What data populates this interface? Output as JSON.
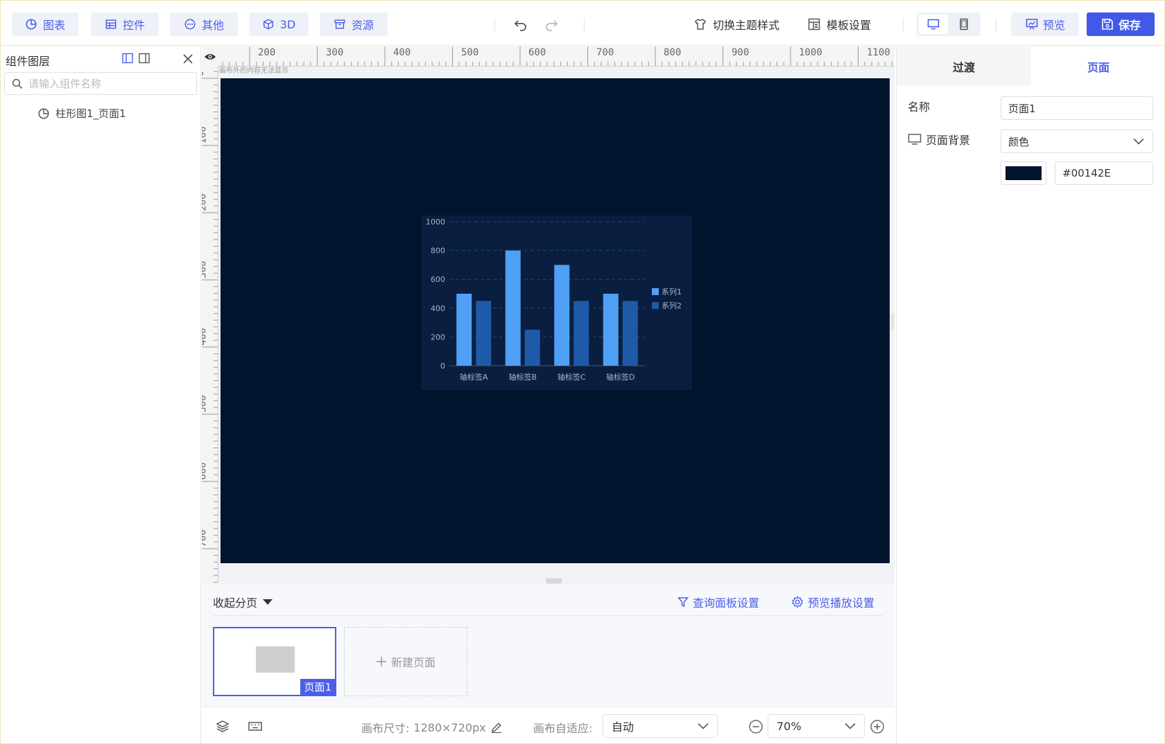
{
  "toolbar": {
    "chart": "图表",
    "control": "控件",
    "other": "其他",
    "threed": "3D",
    "resource": "资源",
    "switch_theme": "切换主题样式",
    "template_settings": "模板设置",
    "preview": "预览",
    "save": "保存"
  },
  "layers": {
    "title": "组件图层",
    "search_placeholder": "请输入组件名称",
    "items": [
      {
        "label": "柱形图1_页面1"
      }
    ]
  },
  "ruler": {
    "top_ticks": [
      "200",
      "300",
      "400",
      "500",
      "600",
      "700",
      "800",
      "900",
      "1000",
      "1100"
    ],
    "left_ticks": [
      "0",
      "100",
      "200",
      "300",
      "400",
      "500",
      "600",
      "700"
    ],
    "hint": "画布外的内容无法显示"
  },
  "canvas": {
    "background": "#00142E"
  },
  "chart_data": {
    "type": "bar",
    "categories": [
      "轴标签A",
      "轴标签B",
      "轴标签C",
      "轴标签D"
    ],
    "series": [
      {
        "name": "系列1",
        "values": [
          500,
          800,
          700,
          500
        ],
        "color": "#4fa0f5"
      },
      {
        "name": "系列2",
        "values": [
          450,
          250,
          450,
          450
        ],
        "color": "#1d5aa8"
      }
    ],
    "ylim": [
      0,
      1000
    ],
    "y_ticks": [
      "0",
      "200",
      "400",
      "600",
      "800",
      "1000"
    ],
    "grid": true,
    "legend": "right"
  },
  "pages": {
    "collapse": "收起分页",
    "query_panel": "查询面板设置",
    "preview_play": "预览播放设置",
    "items": [
      {
        "label": "页面1"
      }
    ],
    "new_page": "新建页面"
  },
  "status": {
    "canvas_size_label": "画布尺寸:",
    "canvas_size_value": "1280×720px",
    "fit_label": "画布自适应:",
    "fit_value": "自动",
    "zoom": "70%"
  },
  "properties": {
    "tab_transition": "过渡",
    "tab_page": "页面",
    "name_label": "名称",
    "name_value": "页面1",
    "bg_label": "页面背景",
    "bg_type": "颜色",
    "bg_color": "#00142E"
  }
}
